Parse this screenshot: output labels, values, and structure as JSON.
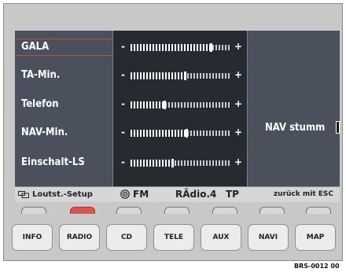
{
  "menu": [
    {
      "label": "GALA",
      "level": 0.82,
      "active": true
    },
    {
      "label": "TA-Min.",
      "level": 0.55,
      "active": false
    },
    {
      "label": "Telefon",
      "level": 0.34,
      "active": false
    },
    {
      "label": "NAV-Min.",
      "level": 0.57,
      "active": false
    },
    {
      "label": "Einschalt-LS",
      "level": 0.42,
      "active": false
    }
  ],
  "slider": {
    "minus": "-",
    "plus": "+"
  },
  "nav_mute": {
    "label": "NAV stumm"
  },
  "status": {
    "setup_label": "Loutst.-Setup",
    "band": "FM",
    "station": "RÄdio.4",
    "tp": "TP",
    "back_label": "zurück mit ESC"
  },
  "softkeys": {
    "count": 7,
    "lit_index": 1
  },
  "buttons": [
    "INFO",
    "RADIO",
    "CD",
    "TELE",
    "AUX",
    "NAVI",
    "MAP"
  ],
  "credit": "BRS-0012 00",
  "colors": {
    "screen": "#333842",
    "accent": "#c64a3a",
    "softkey_lit": "#d9534f"
  },
  "icons": {
    "setup": "speaker-setup-icon",
    "radio": "radio-signal-icon"
  }
}
